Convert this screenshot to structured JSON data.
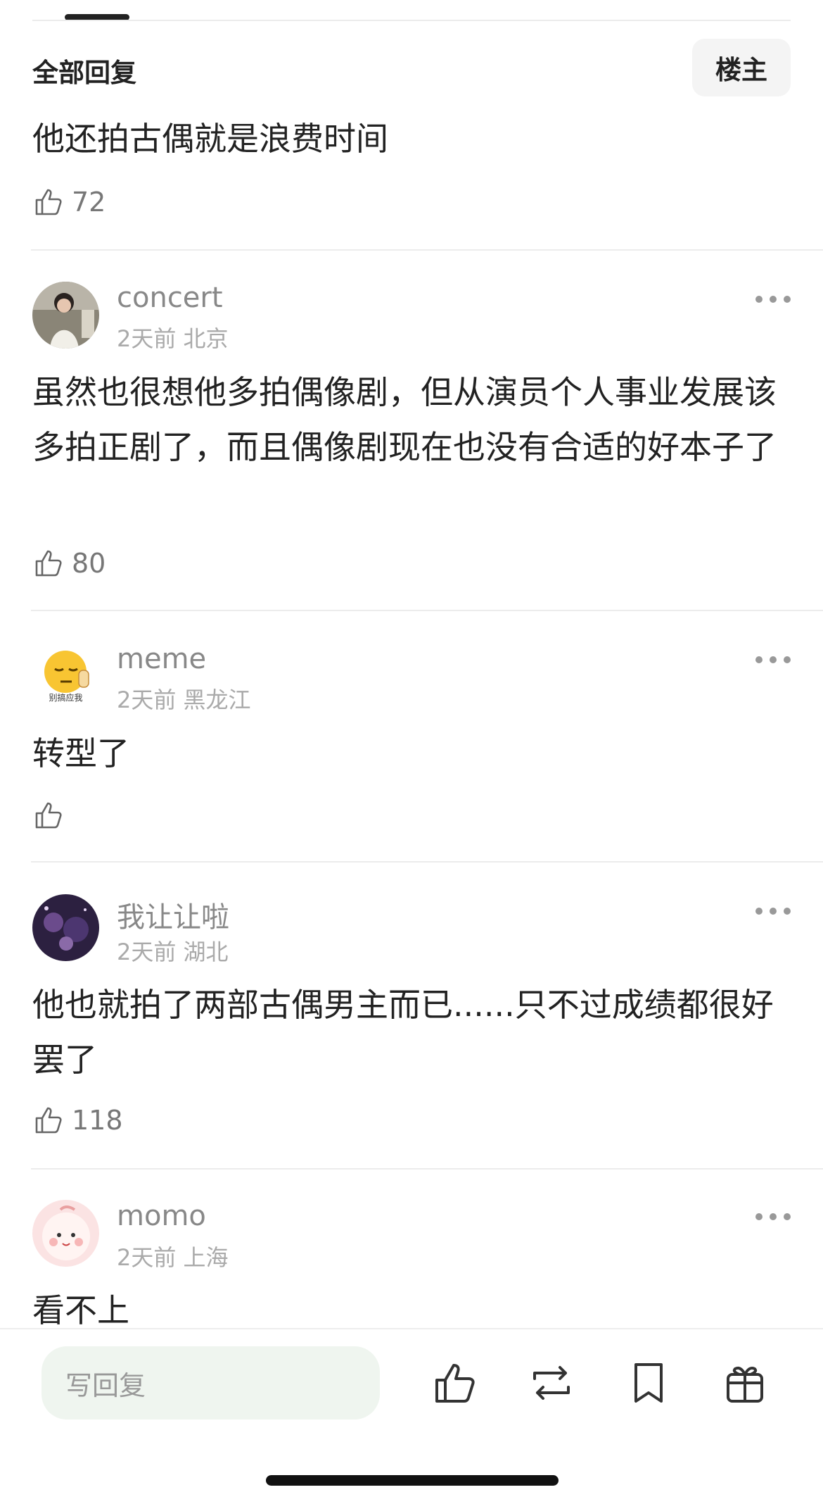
{
  "header": {
    "title": "全部回复",
    "op_filter": "楼主"
  },
  "bottom_bar": {
    "reply_placeholder": "写回复"
  },
  "comments": [
    {
      "text": "他还拍古偶就是浪费时间",
      "likes": "72"
    },
    {
      "username": "concert",
      "time": "2天前",
      "location": "北京",
      "text": "虽然也很想他多拍偶像剧，但从演员个人事业发展该多拍正剧了，而且偶像剧现在也没有合适的好本子了",
      "likes": "80"
    },
    {
      "username": "meme",
      "time": "2天前",
      "location": "黑龙江",
      "avatar_caption": "别搞应我",
      "text": "转型了",
      "likes": ""
    },
    {
      "username": "我让让啦",
      "time": "2天前",
      "location": "湖北",
      "text": "他也就拍了两部古偶男主而已......只不过成绩都很好罢了",
      "likes": "118"
    },
    {
      "username": "momo",
      "time": "2天前",
      "location": "上海",
      "text": "看不上",
      "likes": ""
    }
  ],
  "icons": [
    "thumb-up-icon",
    "more-dots-icon",
    "repost-icon",
    "bookmark-icon",
    "gift-icon"
  ],
  "colors": {
    "text": "#222222",
    "meta": "#aaaaaa",
    "input_bg": "#eff5ef",
    "divider": "#ececec"
  }
}
